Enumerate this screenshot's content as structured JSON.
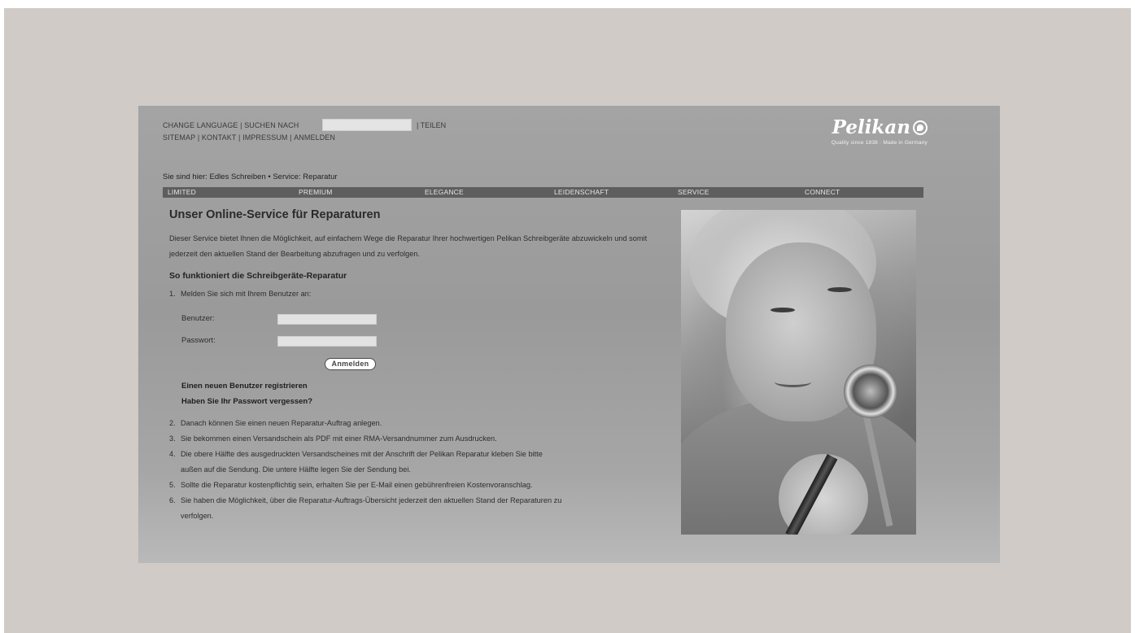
{
  "header": {
    "line1": [
      "CHANGE LANGUAGE",
      "|",
      "SUCHEN NACH"
    ],
    "share": "| TEILEN",
    "line2": [
      "SITEMAP",
      "|",
      "KONTAKT",
      "|",
      "IMPRESSUM",
      "|",
      "ANMELDEN"
    ],
    "search": {
      "value": "",
      "placeholder": ""
    }
  },
  "logo": {
    "word": "Pelikan",
    "tagline": "Quality since 1838 · Made in Germany"
  },
  "breadcrumb": "Sie sind hier: Edles Schreiben • Service: Reparatur",
  "nav": [
    "LIMITED",
    "PREMIUM",
    "ELEGANCE",
    "LEIDENSCHAFT",
    "SERVICE",
    "CONNECT"
  ],
  "content": {
    "title": "Unser Online-Service für Reparaturen",
    "intro": "Dieser Service bietet Ihnen die Möglichkeit, auf einfachem Wege die Reparatur Ihrer hochwertigen Pelikan Schreibgeräte abzuwickeln und somit jederzeit den aktuellen Stand der Bearbeitung abzufragen und zu verfolgen.",
    "howto_heading": "So funktioniert die Schreibgeräte-Reparatur",
    "step1": {
      "num": "1.",
      "text": "Melden Sie sich mit Ihrem Benutzer an:"
    },
    "form": {
      "user_label": "Benutzer:",
      "password_label": "Passwort:",
      "user_value": "",
      "password_value": "",
      "login_button": "Anmelden"
    },
    "register_link": "Einen neuen Benutzer registrieren",
    "forgot_link": "Haben Sie Ihr Passwort vergessen?",
    "steps": [
      {
        "num": "2.",
        "text": "Danach können Sie einen neuen Reparatur-Auftrag anlegen."
      },
      {
        "num": "3.",
        "text": "Sie bekommen einen Versandschein als PDF mit einer RMA-Versandnummer zum Ausdrucken."
      },
      {
        "num": "4.",
        "text": "Die obere Hälfte des ausgedruckten Versandscheines mit der Anschrift der Pelikan Reparatur kleben Sie bitte",
        "cont": "außen auf die Sendung. Die untere Hälfte legen Sie der Sendung bei."
      },
      {
        "num": "5.",
        "text": "Sollte die Reparatur kostenpflichtig sein, erhalten Sie per E-Mail einen gebührenfreien Kostenvoranschlag."
      },
      {
        "num": "6.",
        "text": "Sie haben die Möglichkeit, über die Reparatur-Auftrags-Übersicht jederzeit den aktuellen Stand der Reparaturen zu",
        "cont": "verfolgen."
      }
    ]
  },
  "colors": {
    "outer_bg": "#d0cbc6",
    "site_bg": "#a0a0a0",
    "nav_bg": "#5e5e5e"
  }
}
